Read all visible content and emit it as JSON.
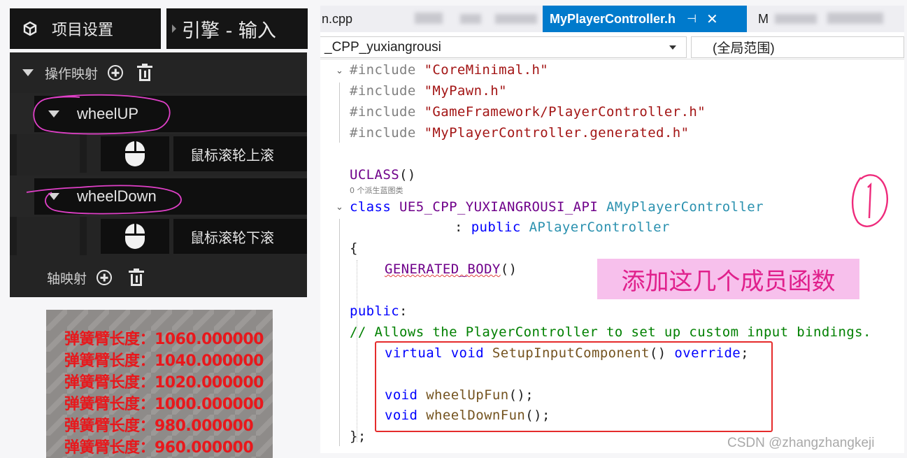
{
  "unreal": {
    "tab_project_settings": "项目设置",
    "tab_engine_input": "引擎 - 输入",
    "action_mappings_label": "操作映射",
    "axis_mappings_label": "轴映射",
    "mappings": [
      {
        "name": "wheelUP",
        "key": "鼠标滚轮上滚"
      },
      {
        "name": "wheelDown",
        "key": "鼠标滚轮下滚"
      }
    ]
  },
  "debug_messages": [
    "弹簧臂长度：1060.000000",
    "弹簧臂长度：1040.000000",
    "弹簧臂长度：1020.000000",
    "弹簧臂长度：1000.000000",
    "弹簧臂长度：980.000000",
    "弹簧臂长度：960.000000"
  ],
  "editor": {
    "tabs": {
      "left_partial": "n.cpp",
      "active": "MyPlayerController.h",
      "right_partial": "M"
    },
    "nav": {
      "project_combo": "_CPP_yuxiangrousi",
      "scope_combo": "(全局范围)"
    },
    "code": {
      "line1_directive": "#include",
      "line1_file": "\"CoreMinimal.h\"",
      "line2_directive": "#include",
      "line2_file": "\"MyPawn.h\"",
      "line3_directive": "#include",
      "line3_file": "\"GameFramework/PlayerController.h\"",
      "line4_directive": "#include",
      "line4_file": "\"MyPlayerController.generated.h\"",
      "uclass_macro": "UCLASS",
      "uclass_paren": "()",
      "derived_hint": "0 个派生蓝图类",
      "class_kw": "class",
      "api_macro": "UE5_CPP_YUXIANGROUSI_API",
      "class_name": "AMyPlayerController",
      "inherit_colon": ": ",
      "public_kw": "public",
      "base_class": "APlayerController",
      "open_brace": "{",
      "generated_body": "GENERATED_BODY",
      "generated_paren": "()",
      "public_label": "public",
      "public_colon": ":",
      "comment": "// Allows the PlayerController to set up custom input bindings.",
      "virtual_kw": "virtual",
      "void_kw1": "void",
      "setup_fn": "SetupInputComponent",
      "setup_paren": "()",
      "override_kw": "override",
      "semicolon1": ";",
      "void_kw2": "void",
      "wheelup_fn": "wheelUpFun",
      "wheelup_tail": "();",
      "void_kw3": "void",
      "wheeldown_fn": "wheelDownFun",
      "wheeldown_tail": "();",
      "close_brace": "};"
    },
    "annotation": "添加这几个成员函数",
    "handwritten_marker": "①"
  },
  "watermark": "CSDN @zhangzhangkeji",
  "colors": {
    "ue_background": "#242424",
    "debug_text": "#e8181c",
    "vs_active_tab": "#007acc",
    "highlight_box": "#e52b2b",
    "annotation_bg": "#f7c0ec",
    "annotation_text": "#e0208c",
    "handwriting": "#ee2a7b"
  }
}
